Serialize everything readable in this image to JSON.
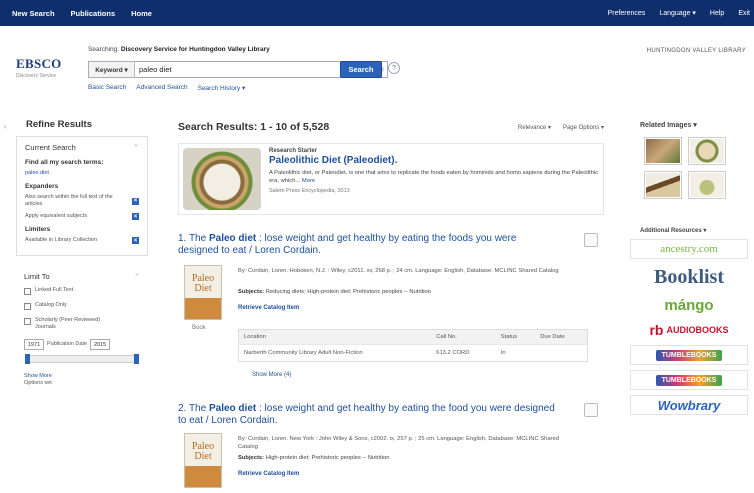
{
  "topnav": {
    "left": [
      "New Search",
      "Publications",
      "Home"
    ],
    "right": [
      "Preferences",
      "Language ▾",
      "Help",
      "Exit"
    ]
  },
  "header": {
    "logo": "EBSCO",
    "logo_sub": "Discovery Service",
    "searching_prefix": "Searching:",
    "searching_target": "Discovery Service for Huntingdon Valley Library",
    "field_select": "Keyword ▾",
    "query": "paleo diet",
    "search_button": "Search",
    "links": [
      "Basic Search",
      "Advanced Search",
      "Search History ▾"
    ],
    "library_name": "HUNTINGDON VALLEY LIBRARY"
  },
  "sidebar": {
    "title": "Refine Results",
    "current_search": {
      "label": "Current Search",
      "find_all": "Find all my search terms:",
      "term": "paleo diet",
      "expanders_label": "Expanders",
      "expanders": [
        "Also search within the full text of the articles",
        "Apply equivalent subjects"
      ],
      "limiters_label": "Limiters",
      "limiters": [
        "Available in Library Collection"
      ]
    },
    "limit_to": {
      "label": "Limit To",
      "options": [
        "Linked Full Text",
        "Catalog Only",
        "Scholarly (Peer Reviewed) Journals"
      ],
      "date_from": "1971",
      "date_label": "Publication Date",
      "date_to": "2015",
      "show_more": "Show More",
      "options_set": "Options set"
    }
  },
  "results": {
    "title": "Search Results: 1 - 10 of 5,528",
    "sort": "Relevance ▾",
    "page_options": "Page Options ▾",
    "starter": {
      "label": "Research Starter",
      "title": "Paleolithic Diet (Paleodiet).",
      "desc": "A Paleolithic diet, or Paleodiet, is one that aims to replicate the foods eaten by hominids and homo sapiens during the Paleolithic era, which...",
      "more": "More",
      "source": "Salem Press Encyclopedia, 2013"
    },
    "items": [
      {
        "num": "1.",
        "title_pre": "The ",
        "title_bold1": "Paleo diet",
        "title_mid": " : lose weight and get healthy by eating the foods you were designed to eat / Loren Cordain.",
        "cover": "Paleo Diet",
        "type": "Book",
        "meta": "By: Cordain, Loren. Hoboken, N.J. : Wiley, c2011. xv, 268 p. ; 24 cm. Language: English, Database: MCLINC Shared Catalog",
        "subjects_label": "Subjects:",
        "subjects": "Reducing diets; High-protein diet; Prehistoric peoples -- Nutrition",
        "retrieve": "Retrieve Catalog Item",
        "table_headers": [
          "Location",
          "Call No.",
          "Status",
          "Due Date"
        ],
        "table_row": [
          "Narberth Community Library Adult Non-Fiction",
          "613.2 CORD",
          "In",
          ""
        ],
        "show_more": "Show More (4)"
      },
      {
        "num": "2.",
        "title_pre": "The ",
        "title_bold1": "Paleo diet",
        "title_mid": " : lose weight and get healthy by eating the food you were designed to eat / Loren Cordain.",
        "cover": "Paleo Diet",
        "meta": "By: Cordain, Loren. New York : John Wiley & Sons, c2002. ix, 257 p. ; 25 cm. Language: English, Database: MCLINC Shared Catalog",
        "subjects_label": "Subjects:",
        "subjects": "High-protein diet; Prehistoric peoples -- Nutrition",
        "retrieve": "Retrieve Catalog Item"
      }
    ]
  },
  "right": {
    "related_images": "Related Images ▾",
    "additional_resources": "Additional Resources ▾",
    "resources": [
      "ancestry.com",
      "Booklist",
      "mángo",
      "AUDIOBOOKS",
      "TUMBLEBOOKS",
      "TUMBLEBOOKS",
      "Wowbrary"
    ]
  }
}
